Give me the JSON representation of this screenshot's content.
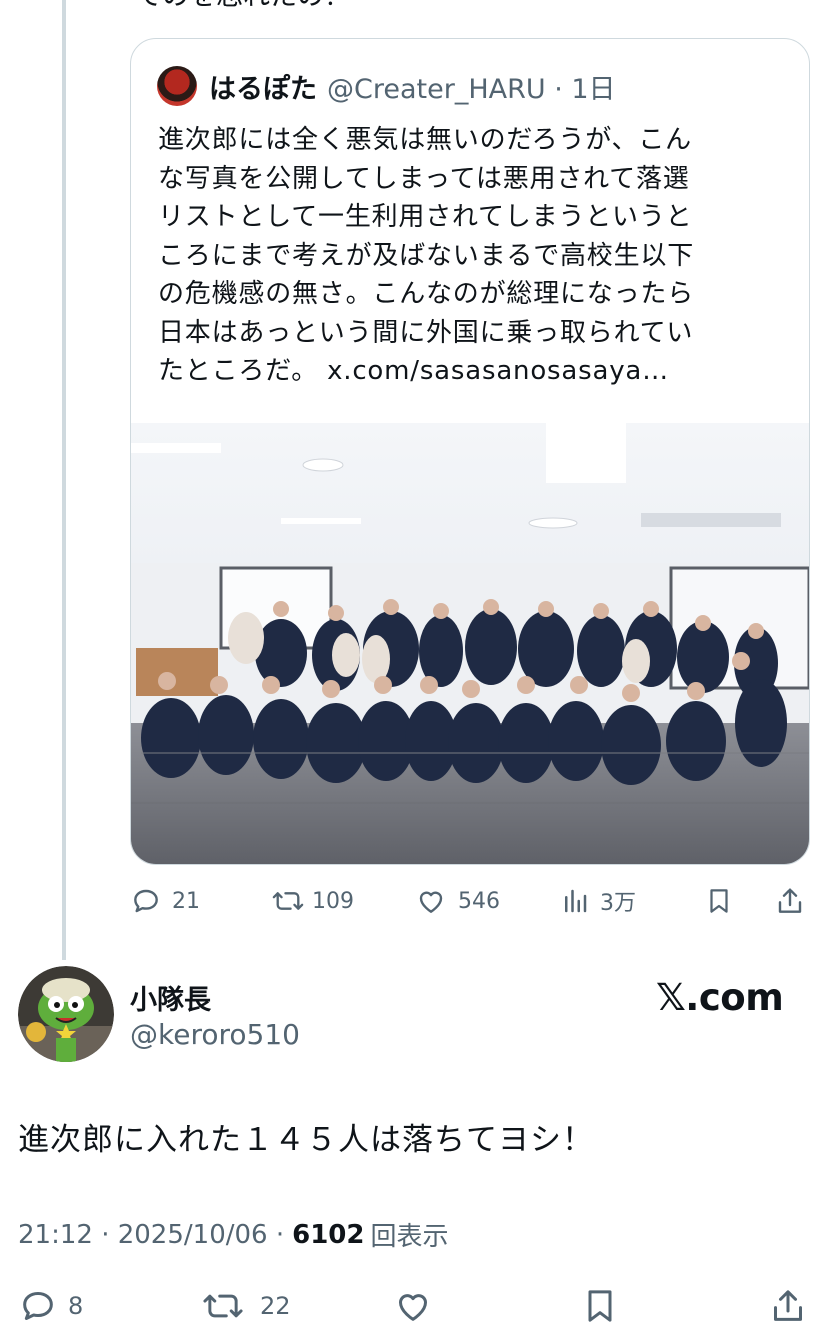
{
  "thread": {
    "cut_text": "てのを忘れたの？"
  },
  "quote": {
    "display_name": "はるぽた",
    "handle_time": "@Creater_HARU · 1日",
    "text": "進次郎には全く悪気は無いのだろうが、こん\nな写真を公開してしまっては悪用されて落選\nリストとして一生利用されてしまうというと\nころにまで考えが及ばないまるで高校生以下\nの危機感の無さ。こんなのが総理になったら\n日本はあっという間に外国に乗っ取られてい\nたところだ。 x.com/sasasanosasaya…",
    "photo_icon": "group-photo-image",
    "actions": {
      "replies": "21",
      "reposts": "109",
      "likes": "546",
      "views": "3万"
    }
  },
  "post": {
    "display_name": "小隊長",
    "handle": "@keroro510",
    "source_label": "𝕏.com",
    "text": "進次郎に入れた１４５人は落ちてヨシ！",
    "timestamp": "21:12 · 2025/10/06 ·",
    "view_count": "6102",
    "view_label": "回表示",
    "actions": {
      "replies": "8",
      "reposts": "22"
    }
  },
  "colors": {
    "text": "#0f1419",
    "muted": "#536471",
    "border": "#cfd9de"
  }
}
